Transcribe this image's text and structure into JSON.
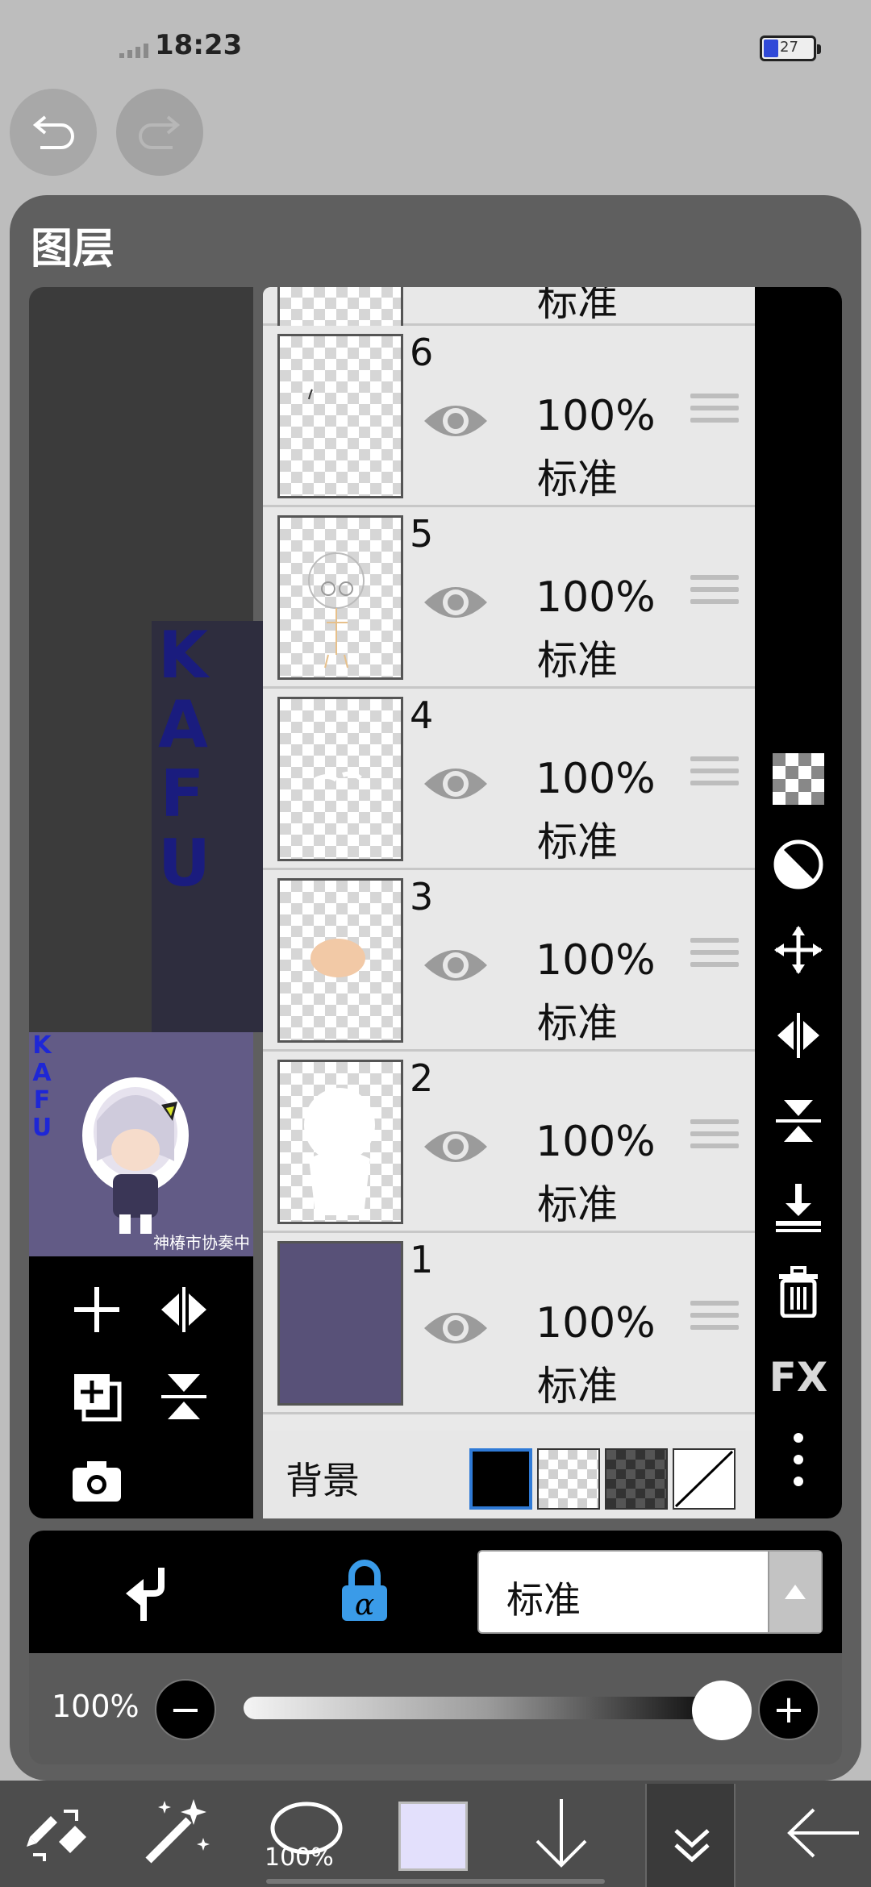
{
  "status_bar": {
    "time": "18:23",
    "battery_level": "27"
  },
  "panel": {
    "title": "图层"
  },
  "canvas_preview": {
    "vertical_text": [
      "K",
      "A",
      "F",
      "U"
    ],
    "signature_text": "神椿市协奏中"
  },
  "layers": [
    {
      "number": "",
      "opacity": "",
      "mode": "标准",
      "thumb": "transparent"
    },
    {
      "number": "6",
      "opacity": "100%",
      "mode": "标准",
      "thumb": "transparent"
    },
    {
      "number": "5",
      "opacity": "100%",
      "mode": "标准",
      "thumb": "transparent"
    },
    {
      "number": "4",
      "opacity": "100%",
      "mode": "标准",
      "thumb": "transparent"
    },
    {
      "number": "3",
      "opacity": "100%",
      "mode": "标准",
      "thumb": "transparent"
    },
    {
      "number": "2",
      "opacity": "100%",
      "mode": "标准",
      "thumb": "transparent"
    },
    {
      "number": "1",
      "opacity": "100%",
      "mode": "标准",
      "thumb": "solid"
    }
  ],
  "background": {
    "label": "背景",
    "options": [
      "black",
      "white",
      "dark-checker",
      "none"
    ],
    "selected": "black"
  },
  "right_tools": {
    "fx_label": "FX",
    "icons": [
      "checker-icon",
      "half-circle-icon",
      "move-icon",
      "flip-horizontal-icon",
      "flip-vertical-icon",
      "merge-down-icon",
      "trash-icon",
      "fx-icon",
      "more-icon"
    ]
  },
  "left_tools": {
    "icons": [
      "add-layer-icon",
      "flip-horizontal-icon",
      "duplicate-layer-icon",
      "flip-vertical-icon",
      "camera-icon"
    ]
  },
  "blend": {
    "clip_icon": "clip-arrow-icon",
    "alpha_lock_icon": "alpha-lock-icon",
    "mode_value": "标准"
  },
  "opacity": {
    "label": "100%",
    "minus": "−",
    "plus": "+",
    "value": 1.0
  },
  "bottom_toolbar": {
    "brush_size_label": "100%",
    "current_color": "#e3e0fc"
  },
  "colors": {
    "panel": "#5f5f5f",
    "accent": "#3a9be8",
    "layer_fill": "#585178"
  }
}
